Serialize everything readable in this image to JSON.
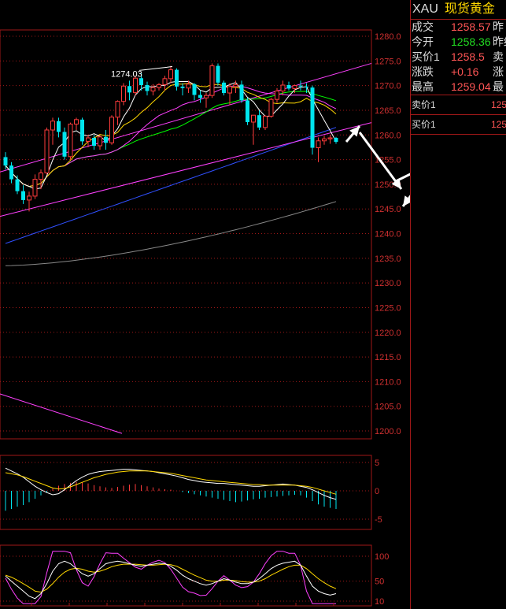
{
  "colors": {
    "up": "#ff3b3b",
    "down": "#00e5ee",
    "grid": "#a01818",
    "axis_text": "#d03030",
    "ma5": "#ffffff",
    "ma10": "#ffd800",
    "ma20": "#ff40ff",
    "ma30": "#00ff00",
    "ma60": "#3050ff",
    "ma120": "#888888",
    "arrow": "#ffffff"
  },
  "quote": {
    "code": "XAU",
    "name": "现货黄金",
    "rows": [
      {
        "label": "成交",
        "value": "1258.57",
        "tone": "red",
        "label2": "昨"
      },
      {
        "label": "今开",
        "value": "1258.36",
        "tone": "green",
        "label2": "昨结"
      },
      {
        "label": "买价1",
        "value": "1258.5",
        "tone": "red",
        "label2": "卖"
      },
      {
        "label": "涨跌",
        "value": "+0.16",
        "tone": "red",
        "label2": "涨"
      },
      {
        "label": "最高",
        "value": "1259.04",
        "tone": "red",
        "label2": "最"
      }
    ],
    "book": [
      {
        "label": "卖价1",
        "value": "125"
      },
      {
        "label": "买价1",
        "value": "125"
      }
    ]
  },
  "chart_data": {
    "type": "candlestick",
    "instrument": "XAU",
    "price_axis": {
      "min": 1200,
      "max": 1280,
      "step": 5,
      "ticks": [
        "1280.0",
        "1275.0",
        "1270.0",
        "1265.0",
        "1260.0",
        "1255.0",
        "1250.0",
        "1245.0",
        "1240.0",
        "1235.0",
        "1230.0",
        "1225.0",
        "1220.0",
        "1215.0",
        "1210.0",
        "1205.0",
        "1200.0"
      ]
    },
    "annotation": {
      "text": "1274.03",
      "price": 1274.03,
      "bar": 28
    },
    "candles": [
      [
        1255.5,
        1256.5,
        1253.0,
        1253.8
      ],
      [
        1253.8,
        1254.5,
        1250.2,
        1251.0
      ],
      [
        1251.0,
        1251.8,
        1248.0,
        1248.6
      ],
      [
        1248.6,
        1249.8,
        1246.0,
        1246.8
      ],
      [
        1246.8,
        1248.5,
        1244.5,
        1247.6
      ],
      [
        1247.6,
        1252.0,
        1247.0,
        1251.0
      ],
      [
        1251.0,
        1253.0,
        1249.0,
        1252.3
      ],
      [
        1252.3,
        1261.5,
        1252.0,
        1261.0
      ],
      [
        1261.0,
        1263.5,
        1258.0,
        1262.8
      ],
      [
        1262.8,
        1263.5,
        1259.5,
        1260.6
      ],
      [
        1260.6,
        1261.5,
        1255.0,
        1255.6
      ],
      [
        1255.6,
        1262.5,
        1255.0,
        1262.2
      ],
      [
        1262.2,
        1263.5,
        1261.0,
        1263.1
      ],
      [
        1263.1,
        1263.5,
        1258.0,
        1258.7
      ],
      [
        1258.7,
        1260.0,
        1257.5,
        1259.4
      ],
      [
        1259.4,
        1260.0,
        1257.0,
        1257.8
      ],
      [
        1257.8,
        1260.0,
        1257.0,
        1259.6
      ],
      [
        1259.6,
        1261.0,
        1257.0,
        1258.4
      ],
      [
        1258.4,
        1264.0,
        1258.0,
        1263.6
      ],
      [
        1263.6,
        1267.0,
        1262.0,
        1266.8
      ],
      [
        1266.8,
        1270.5,
        1266.0,
        1269.9
      ],
      [
        1269.9,
        1271.0,
        1267.0,
        1268.6
      ],
      [
        1268.6,
        1272.0,
        1268.0,
        1271.5
      ],
      [
        1271.5,
        1272.5,
        1269.0,
        1270.1
      ],
      [
        1270.1,
        1270.8,
        1268.0,
        1268.9
      ],
      [
        1268.9,
        1270.3,
        1268.0,
        1269.6
      ],
      [
        1269.6,
        1270.5,
        1269.0,
        1270.2
      ],
      [
        1270.2,
        1272.0,
        1269.0,
        1271.4
      ],
      [
        1271.4,
        1274.0,
        1270.5,
        1273.2
      ],
      [
        1273.2,
        1273.5,
        1269.0,
        1269.8
      ],
      [
        1269.8,
        1270.5,
        1268.0,
        1269.5
      ],
      [
        1269.5,
        1271.0,
        1268.5,
        1270.3
      ],
      [
        1270.3,
        1270.5,
        1267.0,
        1268.1
      ],
      [
        1268.1,
        1269.0,
        1266.5,
        1267.5
      ],
      [
        1267.5,
        1268.5,
        1265.5,
        1268.0
      ],
      [
        1268.0,
        1274.5,
        1267.5,
        1274.0
      ],
      [
        1274.0,
        1274.5,
        1270.0,
        1270.6
      ],
      [
        1270.6,
        1271.0,
        1268.0,
        1268.5
      ],
      [
        1268.5,
        1270.5,
        1266.0,
        1269.8
      ],
      [
        1269.8,
        1271.0,
        1268.5,
        1270.2
      ],
      [
        1270.2,
        1271.0,
        1266.5,
        1267.0
      ],
      [
        1267.0,
        1267.5,
        1262.0,
        1262.6
      ],
      [
        1262.6,
        1264.0,
        1258.0,
        1264.0
      ],
      [
        1264.0,
        1265.0,
        1261.0,
        1261.5
      ],
      [
        1261.5,
        1264.0,
        1261.0,
        1263.8
      ],
      [
        1263.8,
        1267.5,
        1263.5,
        1267.2
      ],
      [
        1267.2,
        1269.5,
        1266.5,
        1268.9
      ],
      [
        1268.9,
        1271.0,
        1268.0,
        1270.1
      ],
      [
        1270.1,
        1270.8,
        1269.0,
        1269.4
      ],
      [
        1269.4,
        1270.2,
        1268.5,
        1270.0
      ],
      [
        1270.0,
        1271.0,
        1269.0,
        1269.8
      ],
      [
        1269.8,
        1270.5,
        1268.5,
        1269.6
      ],
      [
        1269.6,
        1270.0,
        1256.0,
        1257.4
      ],
      [
        1257.4,
        1259.5,
        1254.5,
        1258.8
      ],
      [
        1258.8,
        1259.8,
        1258.0,
        1259.2
      ],
      [
        1259.2,
        1260.0,
        1258.2,
        1259.4
      ],
      [
        1259.4,
        1259.6,
        1258.2,
        1258.6
      ]
    ],
    "macd_axis": {
      "ticks": [
        "5",
        "0",
        "-5"
      ]
    },
    "macd_hist": [
      -3.5,
      -3.2,
      -2.8,
      -2.5,
      -2.0,
      -1.4,
      -0.8,
      -0.3,
      0.4,
      0.9,
      1.2,
      1.4,
      1.6,
      1.5,
      1.3,
      1.0,
      0.8,
      0.6,
      0.5,
      0.7,
      0.9,
      1.1,
      1.2,
      1.0,
      0.8,
      0.6,
      0.4,
      0.3,
      0.2,
      0.0,
      -0.2,
      -0.4,
      -0.6,
      -0.8,
      -1.0,
      -1.2,
      -1.4,
      -1.6,
      -1.8,
      -2.0,
      -1.9,
      -1.7,
      -1.5,
      -1.4,
      -1.2,
      -1.1,
      -1.0,
      -0.9,
      -0.8,
      -0.7,
      -0.8,
      -1.2,
      -1.8,
      -2.4,
      -2.8,
      -3.0,
      -3.2
    ],
    "macd_dif": [
      4.0,
      3.5,
      3.0,
      2.4,
      1.6,
      0.8,
      0.2,
      -0.3,
      -0.7,
      -0.5,
      0.2,
      1.0,
      1.8,
      2.4,
      2.9,
      3.2,
      3.4,
      3.5,
      3.6,
      3.7,
      3.8,
      3.8,
      3.7,
      3.6,
      3.5,
      3.4,
      3.2,
      3.0,
      2.8,
      2.6,
      2.3,
      2.0,
      1.8,
      1.6,
      1.5,
      1.4,
      1.3,
      1.3,
      1.2,
      1.1,
      1.0,
      0.9,
      0.8,
      0.8,
      0.9,
      1.0,
      1.1,
      1.2,
      1.1,
      1.0,
      0.8,
      0.6,
      0.2,
      -0.3,
      -0.8,
      -1.2,
      -1.5
    ],
    "macd_dea": [
      3.2,
      3.0,
      2.8,
      2.5,
      2.1,
      1.7,
      1.3,
      0.9,
      0.5,
      0.3,
      0.4,
      0.7,
      1.1,
      1.5,
      1.9,
      2.3,
      2.6,
      2.9,
      3.1,
      3.3,
      3.4,
      3.5,
      3.5,
      3.5,
      3.5,
      3.4,
      3.3,
      3.2,
      3.1,
      2.9,
      2.7,
      2.5,
      2.3,
      2.1,
      1.9,
      1.8,
      1.7,
      1.6,
      1.5,
      1.4,
      1.3,
      1.2,
      1.1,
      1.1,
      1.0,
      1.0,
      1.0,
      1.0,
      1.0,
      1.0,
      0.9,
      0.8,
      0.6,
      0.3,
      0.0,
      -0.3,
      -0.6
    ],
    "kdj_axis": {
      "ticks": [
        "100",
        "50",
        "10"
      ]
    },
    "kdj_k": [
      60,
      50,
      40,
      30,
      20,
      15,
      25,
      45,
      70,
      85,
      90,
      85,
      75,
      65,
      60,
      65,
      75,
      85,
      88,
      90,
      88,
      85,
      82,
      80,
      82,
      84,
      86,
      85,
      80,
      72,
      62,
      55,
      50,
      45,
      42,
      45,
      50,
      55,
      52,
      48,
      45,
      45,
      48,
      55,
      65,
      75,
      82,
      86,
      88,
      90,
      82,
      60,
      40,
      30,
      25,
      22,
      25
    ],
    "kdj_d": [
      62,
      58,
      52,
      45,
      38,
      30,
      28,
      34,
      45,
      58,
      68,
      74,
      76,
      74,
      70,
      68,
      70,
      74,
      79,
      82,
      84,
      84,
      84,
      83,
      82,
      82,
      83,
      84,
      83,
      80,
      74,
      68,
      62,
      57,
      52,
      50,
      50,
      52,
      52,
      51,
      49,
      48,
      48,
      50,
      55,
      62,
      68,
      74,
      79,
      82,
      82,
      75,
      65,
      55,
      47,
      40,
      35
    ],
    "kdj_j": [
      56,
      34,
      16,
      0,
      -16,
      -15,
      19,
      67,
      120,
      139,
      134,
      107,
      73,
      47,
      40,
      59,
      85,
      107,
      106,
      106,
      96,
      87,
      78,
      74,
      82,
      88,
      92,
      87,
      74,
      56,
      38,
      29,
      26,
      21,
      22,
      35,
      50,
      61,
      52,
      42,
      37,
      39,
      48,
      65,
      85,
      101,
      110,
      110,
      106,
      106,
      82,
      30,
      -10,
      -20,
      -19,
      -14,
      5
    ]
  }
}
